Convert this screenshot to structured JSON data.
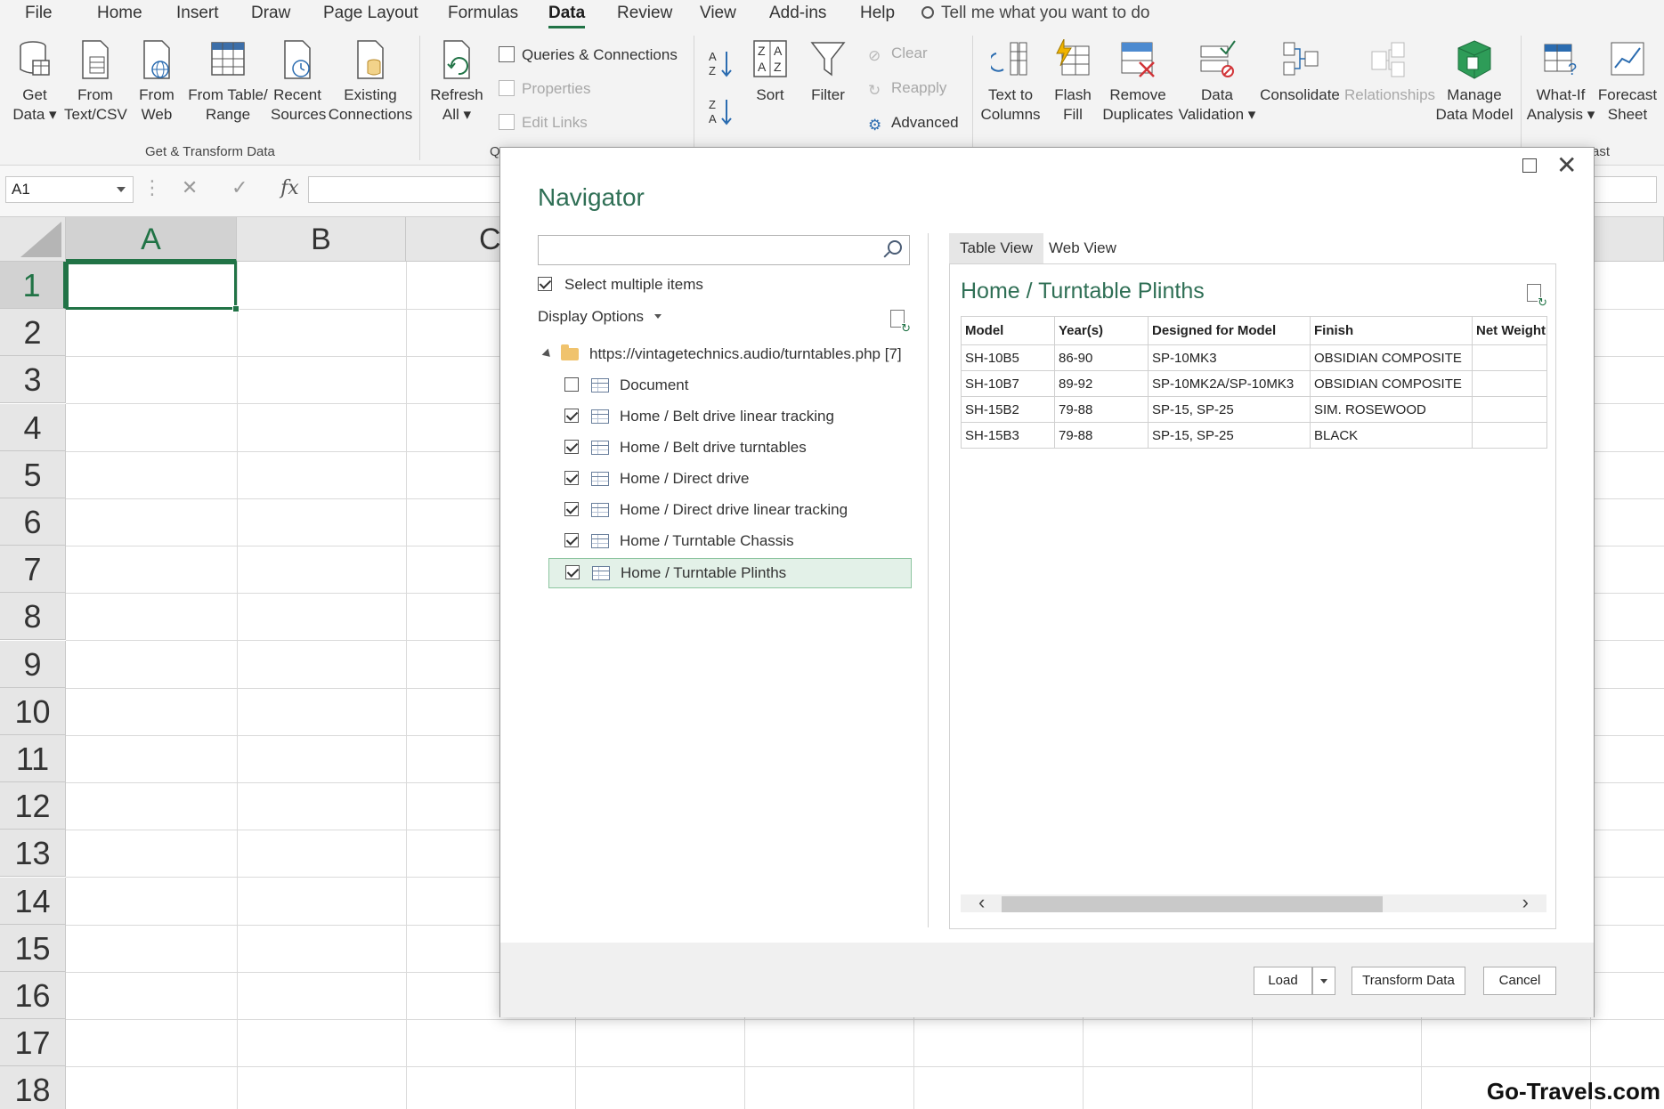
{
  "menu": {
    "tabs": [
      "File",
      "Home",
      "Insert",
      "Draw",
      "Page Layout",
      "Formulas",
      "Data",
      "Review",
      "View",
      "Add-ins",
      "Help"
    ],
    "active_tab": "Data",
    "tell_me": "Tell me what you want to do"
  },
  "ribbon": {
    "get_data": [
      "Get",
      "Data ▾"
    ],
    "from_text_csv": [
      "From",
      "Text/CSV"
    ],
    "from_web": [
      "From",
      "Web"
    ],
    "from_table_range": [
      "From Table/",
      "Range"
    ],
    "recent_sources": [
      "Recent",
      "Sources"
    ],
    "existing_connections": [
      "Existing",
      "Connections"
    ],
    "group_get_transform": "Get & Transform Data",
    "refresh_all": [
      "Refresh",
      "All ▾"
    ],
    "queries_connections": "Queries & Connections",
    "properties": "Properties",
    "edit_links": "Edit Links",
    "group_queries_fragment": "Q",
    "sort": "Sort",
    "filter": "Filter",
    "clear": "Clear",
    "reapply": "Reapply",
    "advanced": "Advanced",
    "text_to_columns": [
      "Text to",
      "Columns"
    ],
    "flash_fill": [
      "Flash",
      "Fill"
    ],
    "remove_duplicates": [
      "Remove",
      "Duplicates"
    ],
    "data_validation": [
      "Data",
      "Validation ▾"
    ],
    "consolidate": "Consolidate",
    "relationships": "Relationships",
    "manage_data_model": [
      "Manage",
      "Data Model"
    ],
    "what_if": [
      "What-If",
      "Analysis ▾"
    ],
    "forecast_sheet": [
      "Forecast",
      "Sheet"
    ],
    "group_forecast_fragment": "ast"
  },
  "formula_bar": {
    "name_box": "A1",
    "cancel_glyph": "✕",
    "enter_glyph": "✓",
    "fx": "fx",
    "formula": ""
  },
  "grid": {
    "columns": [
      "A",
      "B",
      "C"
    ],
    "rows": [
      "1",
      "2",
      "3",
      "4",
      "5",
      "6",
      "7",
      "8",
      "9",
      "10",
      "11",
      "12",
      "13",
      "14",
      "15",
      "16",
      "17",
      "18"
    ],
    "active_cell": "A1"
  },
  "navigator": {
    "title": "Navigator",
    "search_value": "",
    "select_multiple": "Select multiple items",
    "select_multiple_checked": true,
    "display_options": "Display Options",
    "source": "https://vintagetechnics.audio/turntables.php [7]",
    "items": [
      {
        "label": "Document",
        "checked": false
      },
      {
        "label": "Home / Belt drive linear tracking",
        "checked": true
      },
      {
        "label": "Home / Belt drive turntables",
        "checked": true
      },
      {
        "label": "Home / Direct drive",
        "checked": true
      },
      {
        "label": "Home / Direct drive linear tracking",
        "checked": true
      },
      {
        "label": "Home / Turntable Chassis",
        "checked": true
      },
      {
        "label": "Home / Turntable Plinths",
        "checked": true
      }
    ],
    "selected_item": "Home / Turntable Plinths",
    "tabs": [
      "Table View",
      "Web View"
    ],
    "active_tab": "Table View",
    "preview_title": "Home / Turntable Plinths",
    "table": {
      "headers": [
        "Model",
        "Year(s)",
        "Designed for Model",
        "Finish",
        "Net Weight"
      ],
      "rows": [
        [
          "SH-10B5",
          "86-90",
          "SP-10MK3",
          "OBSIDIAN COMPOSITE",
          ""
        ],
        [
          "SH-10B7",
          "89-92",
          "SP-10MK2A/SP-10MK3",
          "OBSIDIAN COMPOSITE",
          ""
        ],
        [
          "SH-15B2",
          "79-88",
          "SP-15, SP-25",
          "SIM. ROSEWOOD",
          ""
        ],
        [
          "SH-15B3",
          "79-88",
          "SP-15, SP-25",
          "BLACK",
          ""
        ]
      ]
    },
    "buttons": {
      "load": "Load",
      "transform": "Transform Data",
      "cancel": "Cancel"
    }
  },
  "watermark": "Go-Travels.com",
  "colors": {
    "excel_green": "#217346",
    "dialog_title": "#2f6f55",
    "selected_item_bg": "#e3f1e8"
  }
}
